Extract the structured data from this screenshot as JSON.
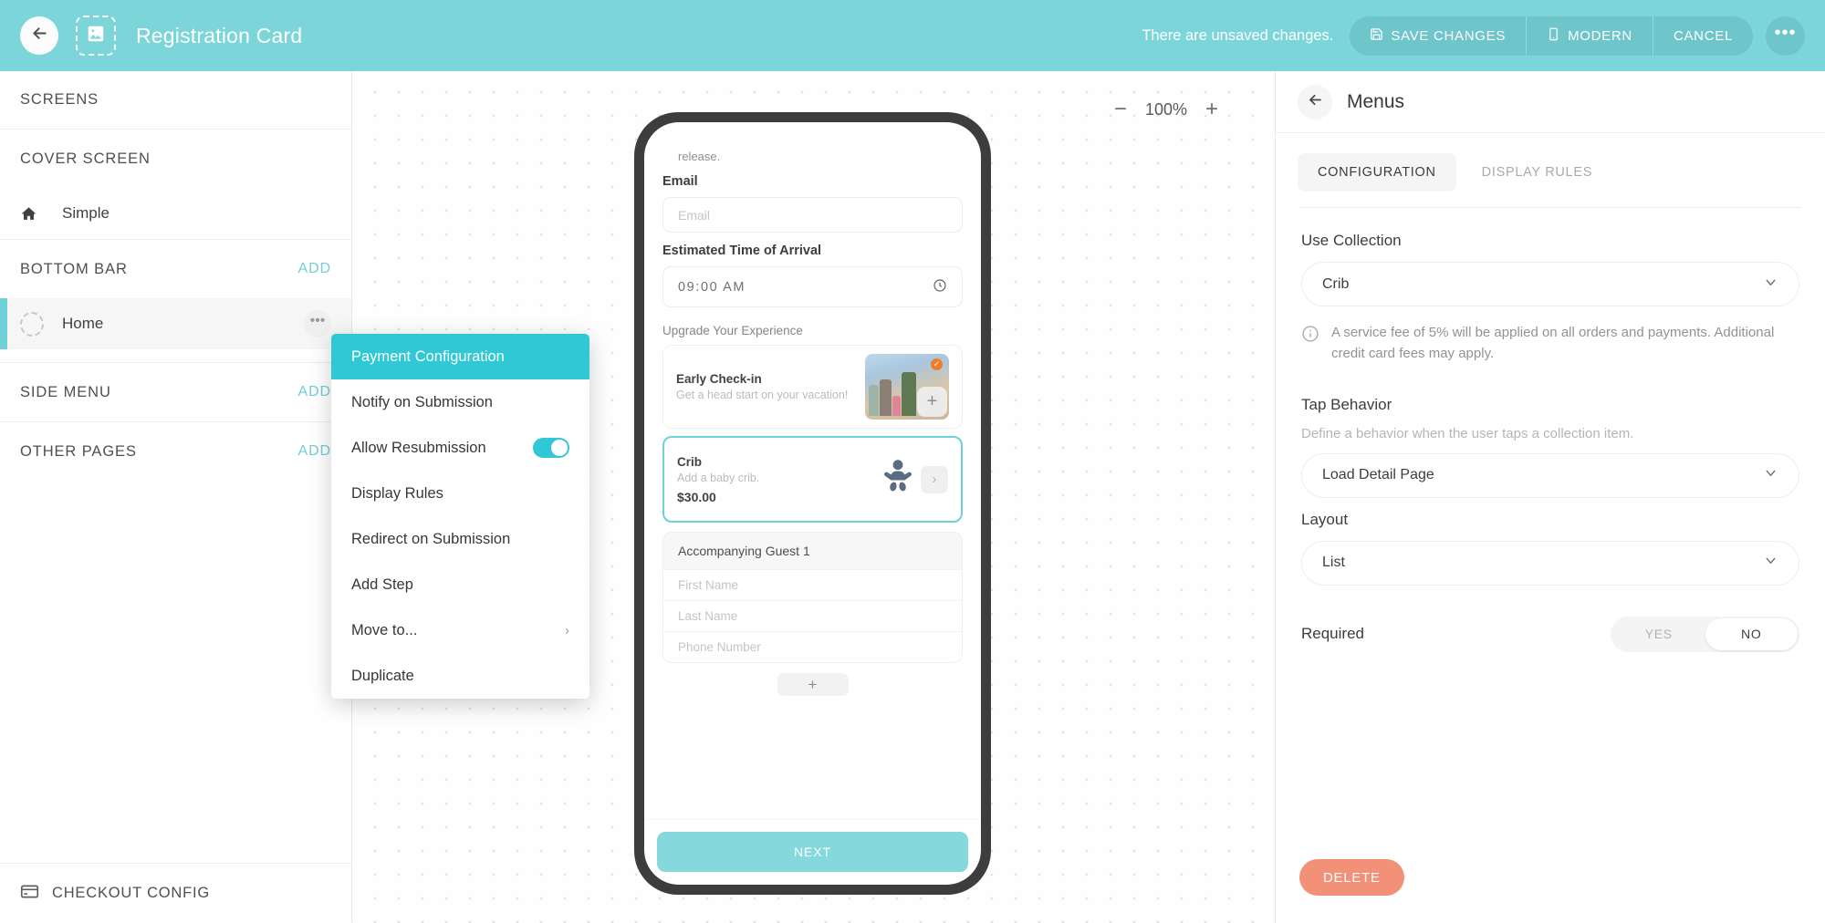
{
  "header": {
    "back_icon": "arrow-left-icon",
    "image_icon": "image-icon",
    "title": "Registration Card",
    "unsaved_text": "There are unsaved changes.",
    "save_label": "SAVE CHANGES",
    "save_icon": "save-icon",
    "modern_label": "MODERN",
    "modern_icon": "phone-icon",
    "cancel_label": "CANCEL",
    "more_label": "•••",
    "bg_color": "#7BD5D9"
  },
  "sidebar": {
    "screens_label": "SCREENS",
    "cover_screen_label": "COVER SCREEN",
    "cover_item": {
      "label": "Simple",
      "icon": "home-icon"
    },
    "bottom_bar_label": "BOTTOM BAR",
    "bottom_bar_add": "ADD",
    "home_item": {
      "label": "Home",
      "icon": "dashed-circle-icon",
      "menu": "•••",
      "selected": true
    },
    "side_menu_label": "SIDE MENU",
    "side_menu_add": "ADD",
    "other_pages_label": "OTHER PAGES",
    "other_pages_add": "ADD",
    "checkout_config_label": "CHECKOUT CONFIG",
    "checkout_icon": "credit-card-icon"
  },
  "canvas": {
    "zoom": {
      "minus": "−",
      "value": "100%",
      "plus": "+"
    }
  },
  "preview": {
    "release_text": "release.",
    "email_label": "Email",
    "email_placeholder": "Email",
    "eta_label": "Estimated Time of Arrival",
    "eta_value": "09:00 AM",
    "eta_icon": "clock-icon",
    "upgrade_label": "Upgrade Your Experience",
    "upgrades": [
      {
        "title": "Early Check-in",
        "subtitle": "Get a head start on your vacation!",
        "price": "",
        "action_icon": "plus-icon",
        "thumb": "airport-family-photo",
        "selected": false
      },
      {
        "title": "Crib",
        "subtitle": "Add a baby crib.",
        "price": "$30.00",
        "action_icon": "chevron-right-icon",
        "thumb": "baby-icon",
        "selected": true
      }
    ],
    "guest_group_title": "Accompanying Guest 1",
    "guest_fields": [
      "First Name",
      "Last Name",
      "Phone Number"
    ],
    "add_guest_icon": "plus-icon",
    "next_label": "NEXT",
    "next_color": "#85D8DC"
  },
  "context_menu": {
    "items": [
      {
        "label": "Payment Configuration",
        "active": true
      },
      {
        "label": "Notify on Submission",
        "active": false
      },
      {
        "label": "Allow Resubmission",
        "active": false,
        "toggle": true,
        "toggle_on": true
      },
      {
        "label": "Display Rules",
        "active": false
      },
      {
        "label": "Redirect on Submission",
        "active": false
      },
      {
        "label": "Add Step",
        "active": false
      },
      {
        "label": "Move to...",
        "active": false,
        "chevron": "›"
      },
      {
        "label": "Duplicate",
        "active": false
      }
    ],
    "highlight_color": "#2FC8D4"
  },
  "right_panel": {
    "back_icon": "arrow-left-icon",
    "title": "Menus",
    "tabs": [
      {
        "label": "CONFIGURATION",
        "active": true
      },
      {
        "label": "DISPLAY RULES",
        "active": false
      }
    ],
    "use_collection_label": "Use Collection",
    "use_collection_value": "Crib",
    "info_icon": "info-icon",
    "info_text": "A service fee of 5% will be applied on all orders and payments. Additional credit card fees may apply.",
    "tap_behavior_label": "Tap Behavior",
    "tap_behavior_desc": "Define a behavior when the user taps a collection item.",
    "tap_behavior_value": "Load Detail Page",
    "layout_label": "Layout",
    "layout_value": "List",
    "required_label": "Required",
    "required_yes": "YES",
    "required_no": "NO",
    "required_selected": "NO",
    "delete_label": "DELETE",
    "delete_color": "#F29177"
  }
}
